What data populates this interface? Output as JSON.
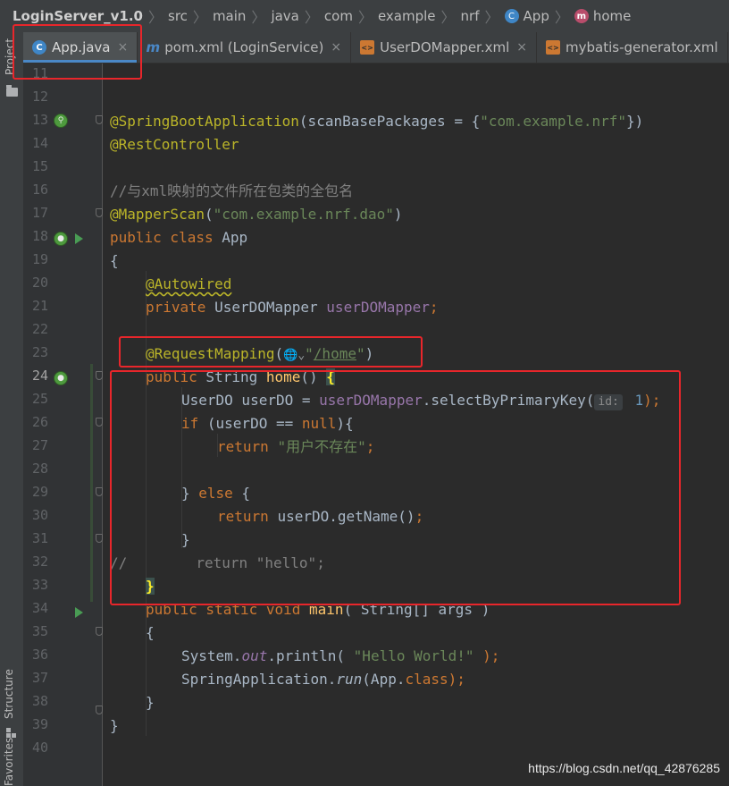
{
  "breadcrumb": [
    {
      "label": "LoginServer_v1.0",
      "icon": "none"
    },
    {
      "label": "src",
      "icon": "none"
    },
    {
      "label": "main",
      "icon": "none"
    },
    {
      "label": "java",
      "icon": "none"
    },
    {
      "label": "com",
      "icon": "none"
    },
    {
      "label": "example",
      "icon": "none"
    },
    {
      "label": "nrf",
      "icon": "none"
    },
    {
      "label": "App",
      "icon": "spring-class-icon"
    },
    {
      "label": "home",
      "icon": "method-icon"
    }
  ],
  "tabs": [
    {
      "label": "App.java",
      "icon": "java-class-icon",
      "active": true
    },
    {
      "label": "pom.xml (LoginService)",
      "icon": "maven-icon",
      "active": false
    },
    {
      "label": "UserDOMapper.xml",
      "icon": "xml-file-icon",
      "active": false
    },
    {
      "label": "mybatis-generator.xml",
      "icon": "xml-file-icon",
      "active": false
    }
  ],
  "close_glyph": "×",
  "tool_windows": {
    "project": "Project",
    "structure": "Structure",
    "favorites": "Favorites"
  },
  "line_numbers": [
    "11",
    "12",
    "13",
    "14",
    "15",
    "16",
    "17",
    "18",
    "19",
    "20",
    "21",
    "22",
    "23",
    "24",
    "25",
    "26",
    "27",
    "28",
    "29",
    "30",
    "31",
    "32",
    "33",
    "34",
    "35",
    "36",
    "37",
    "38",
    "39",
    "40"
  ],
  "current_line": "24",
  "code": {
    "l13": {
      "ann": "@SpringBootApplication",
      "pre": "(scanBasePackages = {",
      "str": "\"com.example.nrf\"",
      "post": "})"
    },
    "l14": {
      "ann": "@RestController"
    },
    "l16": {
      "comment": "//与xml映射的文件所在包类的全包名"
    },
    "l17": {
      "ann": "@MapperScan",
      "pre": "(",
      "str": "\"com.example.nrf.dao\"",
      "post": ")"
    },
    "l18": {
      "kw": "public class",
      "name": " App"
    },
    "l19": {
      "text": "{"
    },
    "l20": {
      "ann": "@Autowired"
    },
    "l21": {
      "kw": "private",
      "type": " UserDOMapper ",
      "field": "userDOMapper",
      "end": ";"
    },
    "l23": {
      "ann": "@RequestMapping",
      "open": "(",
      "globe": "🌐⌄",
      "q1": "\"",
      "path": "/home",
      "q2": "\"",
      "close": ")"
    },
    "l24": {
      "kw": "public",
      "type": " String ",
      "method": "home",
      "paren": "() ",
      "brace": "{"
    },
    "l25": {
      "pre": "UserDO userDO = ",
      "field": "userDOMapper",
      "call": ".selectByPrimaryKey(",
      "hint": "id:",
      "num": " 1",
      "end": ");"
    },
    "l26": {
      "kw1": "if",
      "mid": " (userDO == ",
      "kw2": "null",
      "end": "){"
    },
    "l27": {
      "kw": "return ",
      "str": "\"用户不存在\"",
      "end": ";"
    },
    "l29": {
      "pre": "} ",
      "kw": "else",
      "end": " {"
    },
    "l30": {
      "kw": "return ",
      "call": "userDO.getName()",
      "end": ";"
    },
    "l31": {
      "text": "}"
    },
    "l32": {
      "comment": "//",
      "rest": "        return \"hello\";"
    },
    "l33": {
      "text": "}"
    },
    "l34": {
      "kw": "public static void",
      "name": " main",
      "args": "( String[] args )"
    },
    "l35": {
      "text": "{"
    },
    "l36": {
      "pre": "System.",
      "field": "out",
      "call": ".println( ",
      "str": "\"Hello World!\"",
      "end": " );"
    },
    "l37": {
      "pre": "SpringApplication.",
      "run": "run",
      "args": "(App.",
      "kw": "class",
      "end": ");"
    },
    "l38": {
      "text": "}"
    },
    "l39": {
      "text": "}"
    }
  },
  "watermark": "https://blog.csdn.net/qq_42876285",
  "colors": {
    "keyword": "#cc7832",
    "annotation": "#bbb529",
    "string": "#6a8759",
    "number": "#6897bb",
    "field": "#9876aa",
    "comment": "#808080",
    "default": "#a9b7c6",
    "annotation_box": "#e8262b"
  }
}
